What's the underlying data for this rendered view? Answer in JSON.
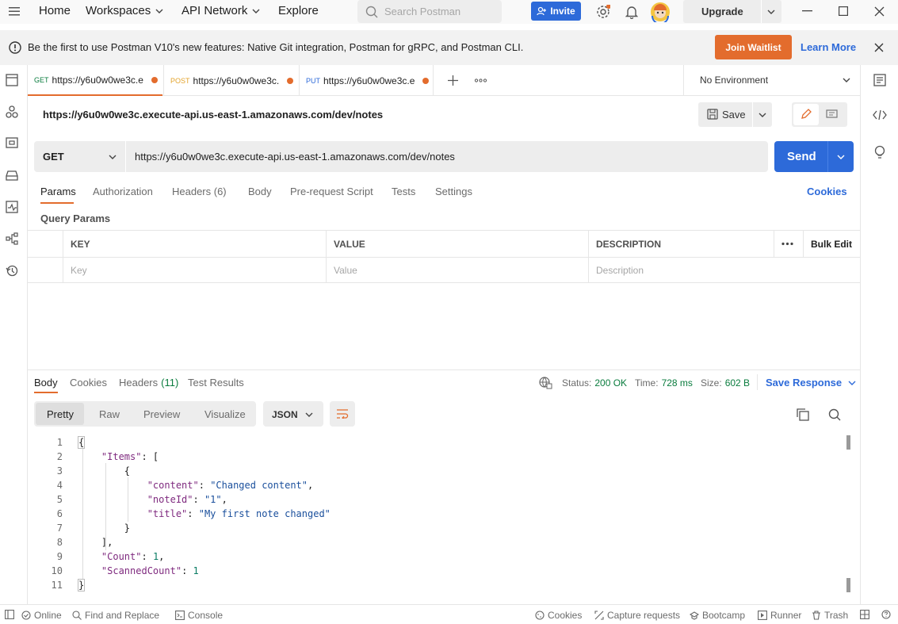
{
  "titlebar": {
    "home": "Home",
    "workspaces": "Workspaces",
    "api_network": "API Network",
    "explore": "Explore",
    "search_placeholder": "Search Postman",
    "invite": "Invite",
    "upgrade": "Upgrade"
  },
  "banner": {
    "message": "Be the first to use Postman V10's new features: Native Git integration, Postman for gRPC, and Postman CLI.",
    "join": "Join Waitlist",
    "learn_more": "Learn More"
  },
  "tabs": [
    {
      "method": "GET",
      "label": "https://y6u0w0we3c.e",
      "method_color": "#0a7c3e"
    },
    {
      "method": "POST",
      "label": "https://y6u0w0we3c.",
      "method_color": "#e3a42d"
    },
    {
      "method": "PUT",
      "label": "https://y6u0w0we3c.e",
      "method_color": "#2d6ad9"
    }
  ],
  "environment": "No Environment",
  "request": {
    "name": "https://y6u0w0we3c.execute-api.us-east-1.amazonaws.com/dev/notes",
    "save": "Save",
    "method": "GET",
    "url": "https://y6u0w0we3c.execute-api.us-east-1.amazonaws.com/dev/notes",
    "send": "Send"
  },
  "request_tabs": {
    "params": "Params",
    "authorization": "Authorization",
    "headers": "Headers (6)",
    "body": "Body",
    "prerequest": "Pre-request Script",
    "tests": "Tests",
    "settings": "Settings",
    "cookies": "Cookies"
  },
  "query_params": {
    "title": "Query Params",
    "headers": {
      "key": "KEY",
      "value": "VALUE",
      "description": "DESCRIPTION",
      "bulk_edit": "Bulk Edit"
    },
    "placeholders": {
      "key": "Key",
      "value": "Value",
      "description": "Description"
    }
  },
  "response": {
    "tabs": {
      "body": "Body",
      "cookies": "Cookies",
      "headers": "Headers",
      "headers_count": "(11)",
      "test_results": "Test Results"
    },
    "status_label": "Status:",
    "status_value": "200 OK",
    "time_label": "Time:",
    "time_value": "728 ms",
    "size_label": "Size:",
    "size_value": "602 B",
    "save_response": "Save Response",
    "views": {
      "pretty": "Pretty",
      "raw": "Raw",
      "preview": "Preview",
      "visualize": "Visualize"
    },
    "format": "JSON",
    "lines": [
      "1",
      "2",
      "3",
      "4",
      "5",
      "6",
      "7",
      "8",
      "9",
      "10",
      "11"
    ]
  },
  "statusbar": {
    "online": "Online",
    "find_replace": "Find and Replace",
    "console": "Console",
    "cookies": "Cookies",
    "capture": "Capture requests",
    "bootcamp": "Bootcamp",
    "runner": "Runner",
    "trash": "Trash"
  },
  "colors": {
    "accent": "#e36c2d",
    "primary": "#2d6ad9",
    "success": "#0a7c3e"
  }
}
